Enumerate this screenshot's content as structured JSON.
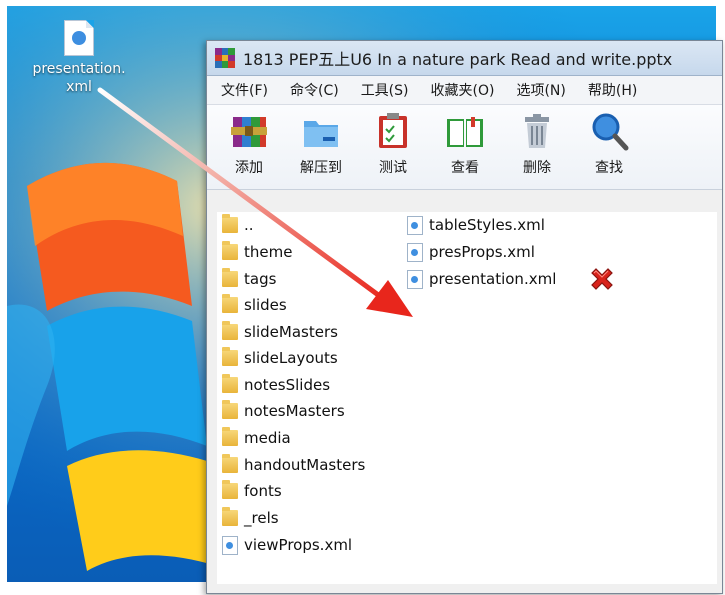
{
  "desktop": {
    "file_icon": {
      "icon": "xml-file-icon",
      "label_line1": "presentation.",
      "label_line2": "xml"
    }
  },
  "window": {
    "title": "1813 PEP五上U6 In a nature park Read and write.pptx",
    "menu": [
      "文件(F)",
      "命令(C)",
      "工具(S)",
      "收藏夹(O)",
      "选项(N)",
      "帮助(H)"
    ],
    "toolbar": [
      {
        "label": "添加",
        "icon": "add-books-icon"
      },
      {
        "label": "解压到",
        "icon": "extract-folder-icon"
      },
      {
        "label": "测试",
        "icon": "test-clipboard-icon"
      },
      {
        "label": "查看",
        "icon": "view-book-icon"
      },
      {
        "label": "删除",
        "icon": "trash-icon"
      },
      {
        "label": "查找",
        "icon": "magnifier-icon"
      }
    ],
    "files_col1": [
      "..",
      "theme",
      "tags",
      "slides",
      "slideMasters",
      "slideLayouts",
      "notesSlides",
      "notesMasters",
      "media",
      "handoutMasters",
      "fonts",
      "_rels",
      "viewProps.xml"
    ],
    "files_col2": [
      "tableStyles.xml",
      "presProps.xml",
      "presentation.xml"
    ]
  },
  "colors": {
    "arrow": "#e8261c",
    "delete_mark": "#d9231b",
    "desktop_blue": "#0a7fd2"
  }
}
